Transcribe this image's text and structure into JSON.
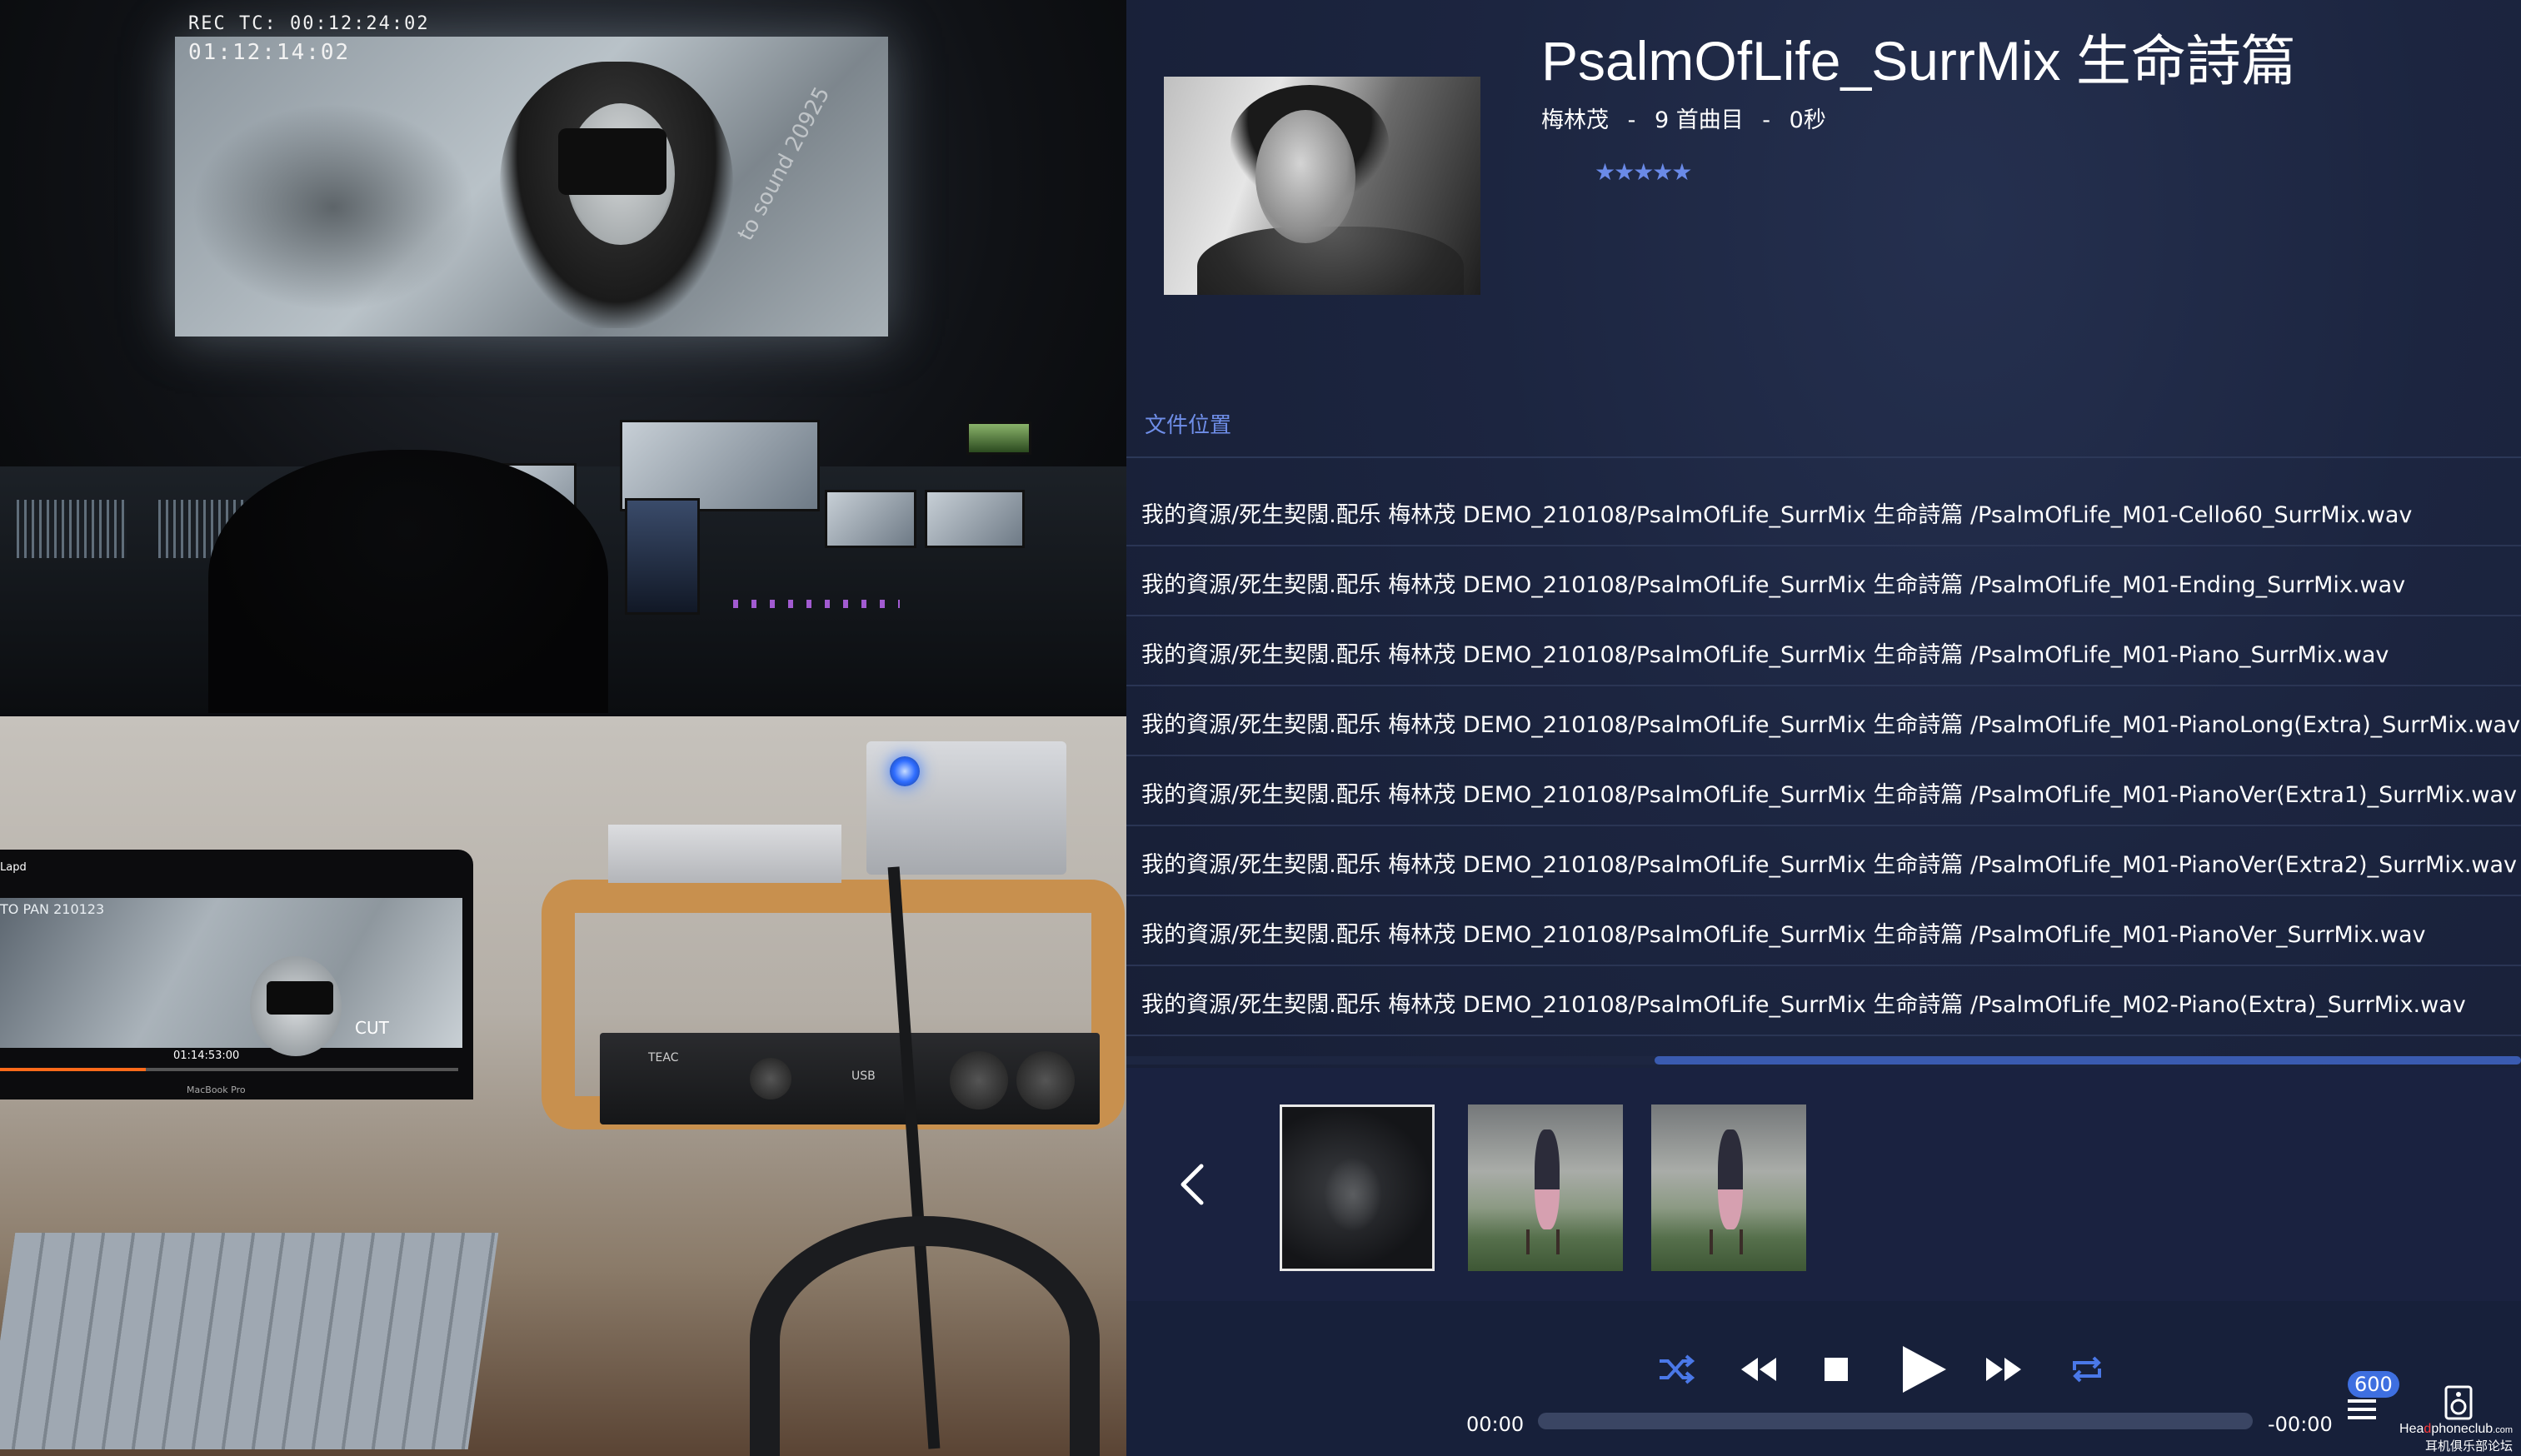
{
  "photos": {
    "top": {
      "timecode_line1": "REC TC: 00:12:24:02",
      "timecode_line2": "01:12:14:02",
      "watermark": "to sound 20925"
    },
    "bottom": {
      "laptop_title": "Lapd",
      "laptop_overlay": "TO PAN 210123",
      "laptop_cut": "CUT",
      "laptop_timecode": "01:14:53:00",
      "laptop_model": "MacBook Pro",
      "amp_brand": "TEAC",
      "amp_usb": "USB"
    }
  },
  "album": {
    "title": "PsalmOfLife_SurrMix 生命詩篇",
    "artist": "梅林茂",
    "separator": "-",
    "track_count": "9 首曲目",
    "duration": "0秒",
    "rating_stars": "★★★★★",
    "rating_value": 5
  },
  "file_location": {
    "label": "文件位置",
    "files": [
      "我的資源/死生契闊.配乐 梅林茂 DEMO_210108/PsalmOfLife_SurrMix 生命詩篇 /PsalmOfLife_M01-Cello60_SurrMix.wav",
      "我的資源/死生契闊.配乐 梅林茂 DEMO_210108/PsalmOfLife_SurrMix 生命詩篇 /PsalmOfLife_M01-Ending_SurrMix.wav",
      "我的資源/死生契闊.配乐 梅林茂 DEMO_210108/PsalmOfLife_SurrMix 生命詩篇 /PsalmOfLife_M01-Piano_SurrMix.wav",
      "我的資源/死生契闊.配乐 梅林茂 DEMO_210108/PsalmOfLife_SurrMix 生命詩篇 /PsalmOfLife_M01-PianoLong(Extra)_SurrMix.wav",
      "我的資源/死生契闊.配乐 梅林茂 DEMO_210108/PsalmOfLife_SurrMix 生命詩篇 /PsalmOfLife_M01-PianoVer(Extra1)_SurrMix.wav",
      "我的資源/死生契闊.配乐 梅林茂 DEMO_210108/PsalmOfLife_SurrMix 生命詩篇 /PsalmOfLife_M01-PianoVer(Extra2)_SurrMix.wav",
      "我的資源/死生契闊.配乐 梅林茂 DEMO_210108/PsalmOfLife_SurrMix 生命詩篇 /PsalmOfLife_M01-PianoVer_SurrMix.wav",
      "我的資源/死生契闊.配乐 梅林茂 DEMO_210108/PsalmOfLife_SurrMix 生命詩篇 /PsalmOfLife_M02-Piano(Extra)_SurrMix.wav"
    ]
  },
  "thumbnails": {
    "selected_index": 0,
    "items": [
      "album-cover-dark",
      "painting-woman",
      "painting-woman"
    ]
  },
  "playback": {
    "elapsed": "00:00",
    "remaining": "-00:00",
    "progress": 0,
    "queue_count": "600"
  },
  "icons": {
    "shuffle": "shuffle-icon",
    "previous": "rewind-icon",
    "stop": "stop-icon",
    "play": "play-icon",
    "next": "fast-forward-icon",
    "repeat": "repeat-icon",
    "queue": "queue-list-icon",
    "speaker": "speaker-icon",
    "back": "chevron-left-icon"
  },
  "colors": {
    "accent": "#4a78e8",
    "background": "#1c2540",
    "rating": "#6a8ae8",
    "badge": "#3e6fe0"
  },
  "watermark_site": {
    "line1_a": "Hea",
    "line1_b": "d",
    "line1_c": "phoneclub",
    "line1_d": ".com",
    "line2": "耳机俱乐部论坛"
  }
}
